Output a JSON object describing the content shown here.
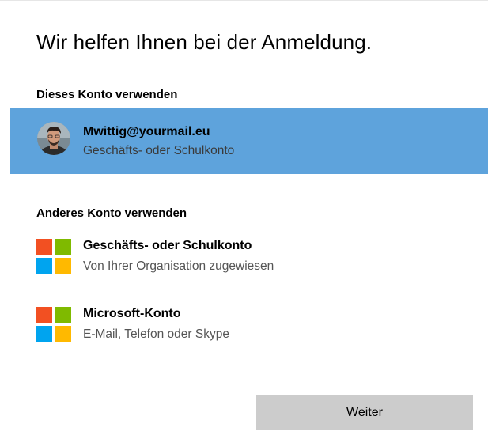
{
  "dialog": {
    "title": "Wir helfen Ihnen bei der Anmeldung."
  },
  "use_this_account": {
    "section_label": "Dieses Konto verwenden",
    "account": {
      "email": "Mwittig@yourmail.eu",
      "type": "Geschäfts- oder Schulkonto",
      "selected": true
    }
  },
  "other_account": {
    "section_label": "Anderes Konto verwenden",
    "options": [
      {
        "title": "Geschäfts- oder Schulkonto",
        "subtitle": "Von Ihrer Organisation zugewiesen",
        "icon": "microsoft-logo-icon"
      },
      {
        "title": "Microsoft-Konto",
        "subtitle": "E-Mail, Telefon oder Skype",
        "icon": "microsoft-logo-icon"
      }
    ]
  },
  "footer": {
    "next_label": "Weiter"
  },
  "colors": {
    "selection": "#5ea3dc",
    "button": "#cccccc",
    "ms_red": "#f25022",
    "ms_green": "#7fba00",
    "ms_blue": "#00a4ef",
    "ms_yellow": "#ffb900"
  }
}
